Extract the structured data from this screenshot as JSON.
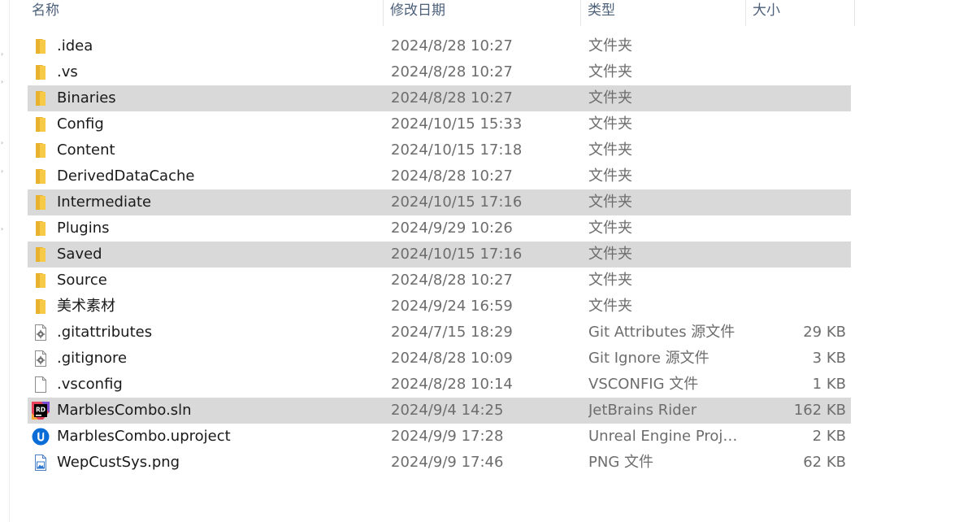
{
  "columns": {
    "name": "名称",
    "modified": "修改日期",
    "type": "类型",
    "size": "大小"
  },
  "files": [
    {
      "name": ".idea",
      "modified": "2024/8/28 10:27",
      "type": "文件夹",
      "size": "",
      "icon": "folder-icon",
      "selected": false
    },
    {
      "name": ".vs",
      "modified": "2024/8/28 10:27",
      "type": "文件夹",
      "size": "",
      "icon": "folder-icon",
      "selected": false
    },
    {
      "name": "Binaries",
      "modified": "2024/8/28 10:27",
      "type": "文件夹",
      "size": "",
      "icon": "folder-icon",
      "selected": true
    },
    {
      "name": "Config",
      "modified": "2024/10/15 15:33",
      "type": "文件夹",
      "size": "",
      "icon": "folder-icon",
      "selected": false
    },
    {
      "name": "Content",
      "modified": "2024/10/15 17:18",
      "type": "文件夹",
      "size": "",
      "icon": "folder-icon",
      "selected": false
    },
    {
      "name": "DerivedDataCache",
      "modified": "2024/8/28 10:27",
      "type": "文件夹",
      "size": "",
      "icon": "folder-icon",
      "selected": false
    },
    {
      "name": "Intermediate",
      "modified": "2024/10/15 17:16",
      "type": "文件夹",
      "size": "",
      "icon": "folder-icon",
      "selected": true
    },
    {
      "name": "Plugins",
      "modified": "2024/9/29 10:26",
      "type": "文件夹",
      "size": "",
      "icon": "folder-icon",
      "selected": false
    },
    {
      "name": "Saved",
      "modified": "2024/10/15 17:16",
      "type": "文件夹",
      "size": "",
      "icon": "folder-icon",
      "selected": true
    },
    {
      "name": "Source",
      "modified": "2024/8/28 10:27",
      "type": "文件夹",
      "size": "",
      "icon": "folder-icon",
      "selected": false
    },
    {
      "name": "美术素材",
      "modified": "2024/9/24 16:59",
      "type": "文件夹",
      "size": "",
      "icon": "folder-icon",
      "selected": false
    },
    {
      "name": ".gitattributes",
      "modified": "2024/7/15 18:29",
      "type": "Git Attributes 源文件",
      "size": "29 KB",
      "icon": "config-file-icon",
      "selected": false
    },
    {
      "name": ".gitignore",
      "modified": "2024/8/28 10:09",
      "type": "Git Ignore 源文件",
      "size": "3 KB",
      "icon": "config-file-icon",
      "selected": false
    },
    {
      "name": ".vsconfig",
      "modified": "2024/8/28 10:14",
      "type": "VSCONFIG 文件",
      "size": "1 KB",
      "icon": "blank-file-icon",
      "selected": false
    },
    {
      "name": "MarblesCombo.sln",
      "modified": "2024/9/4 14:25",
      "type": "JetBrains Rider",
      "size": "162 KB",
      "icon": "rider-icon",
      "selected": true
    },
    {
      "name": "MarblesCombo.uproject",
      "modified": "2024/9/9 17:28",
      "type": "Unreal Engine Proje...",
      "size": "2 KB",
      "icon": "unreal-engine-icon",
      "selected": false
    },
    {
      "name": "WepCustSys.png",
      "modified": "2024/9/9 17:46",
      "type": "PNG 文件",
      "size": "62 KB",
      "icon": "image-file-icon",
      "selected": false
    }
  ],
  "icon_text": {
    "rider": "RD"
  },
  "colors": {
    "folder": "#f5c342",
    "selection": "#d9d9d9",
    "header_text": "#4c607a",
    "unreal_blue": "#0a6cd6"
  }
}
